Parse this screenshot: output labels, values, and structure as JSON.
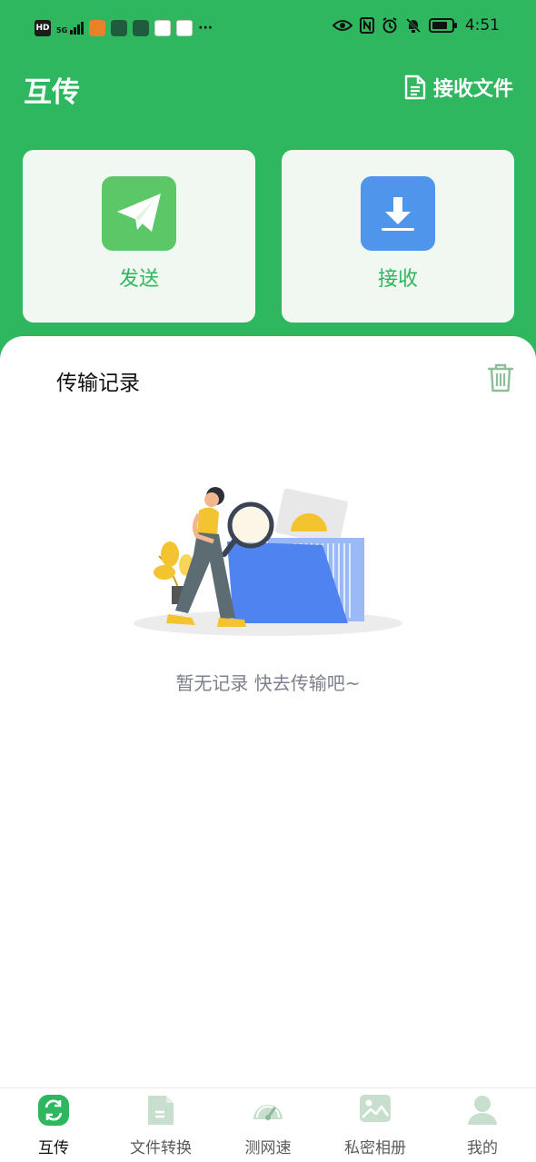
{
  "status_bar": {
    "network_badge": "HD",
    "signal_label": "5G",
    "time": "4:51"
  },
  "header": {
    "title": "互传",
    "receive_files_label": "接收文件"
  },
  "actions": {
    "send_label": "发送",
    "receive_label": "接收"
  },
  "history": {
    "title": "传输记录",
    "empty_text": "暂无记录 快去传输吧~"
  },
  "bottom_nav": {
    "items": [
      {
        "label": "互传",
        "icon": "transfer-icon",
        "active": true
      },
      {
        "label": "文件转换",
        "icon": "file-convert-icon",
        "active": false
      },
      {
        "label": "测网速",
        "icon": "speedometer-icon",
        "active": false
      },
      {
        "label": "私密相册",
        "icon": "photo-album-icon",
        "active": false
      },
      {
        "label": "我的",
        "icon": "profile-icon",
        "active": false
      }
    ]
  },
  "colors": {
    "brand_green": "#2eb75e",
    "send_icon_bg": "#5cc766",
    "receive_icon_bg": "#4f95ec",
    "inactive_nav_icon": "#c7dfcc"
  }
}
